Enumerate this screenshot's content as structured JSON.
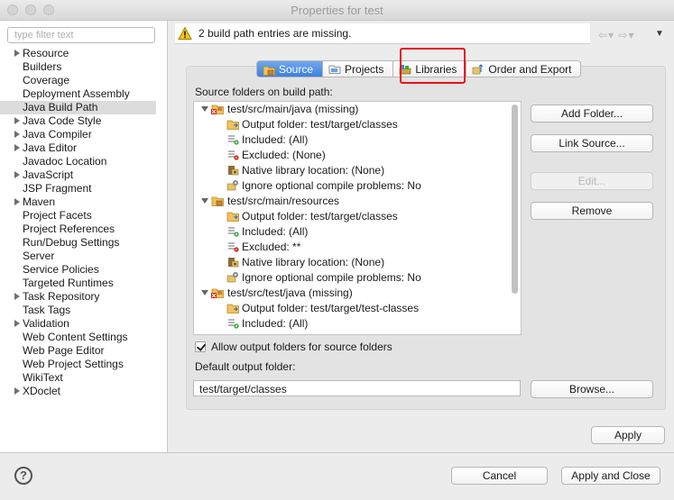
{
  "window": {
    "title": "Properties for test"
  },
  "sidebar": {
    "filter_placeholder": "type filter text",
    "items": [
      {
        "label": "Resource",
        "expandable": true
      },
      {
        "label": "Builders",
        "expandable": false
      },
      {
        "label": "Coverage",
        "expandable": false
      },
      {
        "label": "Deployment Assembly",
        "expandable": false
      },
      {
        "label": "Java Build Path",
        "expandable": false,
        "selected": true
      },
      {
        "label": "Java Code Style",
        "expandable": true
      },
      {
        "label": "Java Compiler",
        "expandable": true
      },
      {
        "label": "Java Editor",
        "expandable": true
      },
      {
        "label": "Javadoc Location",
        "expandable": false
      },
      {
        "label": "JavaScript",
        "expandable": true
      },
      {
        "label": "JSP Fragment",
        "expandable": false
      },
      {
        "label": "Maven",
        "expandable": true
      },
      {
        "label": "Project Facets",
        "expandable": false
      },
      {
        "label": "Project References",
        "expandable": false
      },
      {
        "label": "Run/Debug Settings",
        "expandable": false
      },
      {
        "label": "Server",
        "expandable": false
      },
      {
        "label": "Service Policies",
        "expandable": false
      },
      {
        "label": "Targeted Runtimes",
        "expandable": false
      },
      {
        "label": "Task Repository",
        "expandable": true
      },
      {
        "label": "Task Tags",
        "expandable": false
      },
      {
        "label": "Validation",
        "expandable": true
      },
      {
        "label": "Web Content Settings",
        "expandable": false
      },
      {
        "label": "Web Page Editor",
        "expandable": false
      },
      {
        "label": "Web Project Settings",
        "expandable": false
      },
      {
        "label": "WikiText",
        "expandable": false
      },
      {
        "label": "XDoclet",
        "expandable": true
      }
    ]
  },
  "message": {
    "text": "2 build path entries are missing.",
    "icon": "warning-icon"
  },
  "tabs": [
    {
      "label": "Source",
      "icon": "source-folder-icon",
      "active": true
    },
    {
      "label": "Projects",
      "icon": "projects-icon",
      "active": false
    },
    {
      "label": "Libraries",
      "icon": "libraries-icon",
      "active": false
    },
    {
      "label": "Order and Export",
      "icon": "order-export-icon",
      "active": false
    }
  ],
  "source": {
    "label": "Source folders on build path:",
    "tree": [
      {
        "text": "test/src/main/java (missing)",
        "level": 0,
        "icon": "missing-source-folder-icon"
      },
      {
        "text": "Output folder: test/target/classes",
        "level": 1,
        "icon": "output-folder-icon"
      },
      {
        "text": "Included: (All)",
        "level": 1,
        "icon": "included-icon"
      },
      {
        "text": "Excluded: (None)",
        "level": 1,
        "icon": "excluded-icon"
      },
      {
        "text": "Native library location: (None)",
        "level": 1,
        "icon": "native-library-icon"
      },
      {
        "text": "Ignore optional compile problems: No",
        "level": 1,
        "icon": "ignore-problems-icon"
      },
      {
        "text": "test/src/main/resources",
        "level": 0,
        "icon": "source-folder-icon"
      },
      {
        "text": "Output folder: test/target/classes",
        "level": 1,
        "icon": "output-folder-icon"
      },
      {
        "text": "Included: (All)",
        "level": 1,
        "icon": "included-icon"
      },
      {
        "text": "Excluded: **",
        "level": 1,
        "icon": "excluded-icon"
      },
      {
        "text": "Native library location: (None)",
        "level": 1,
        "icon": "native-library-icon"
      },
      {
        "text": "Ignore optional compile problems: No",
        "level": 1,
        "icon": "ignore-problems-icon"
      },
      {
        "text": "test/src/test/java (missing)",
        "level": 0,
        "icon": "missing-source-folder-icon"
      },
      {
        "text": "Output folder: test/target/test-classes",
        "level": 1,
        "icon": "output-folder-icon"
      },
      {
        "text": "Included: (All)",
        "level": 1,
        "icon": "included-icon"
      }
    ],
    "buttons": {
      "add_folder": "Add Folder...",
      "link_source": "Link Source...",
      "edit": "Edit...",
      "remove": "Remove"
    },
    "allow_output_label": "Allow output folders for source folders",
    "default_output_label": "Default output folder:",
    "default_output_value": "test/target/classes",
    "browse": "Browse..."
  },
  "buttons": {
    "apply": "Apply",
    "cancel": "Cancel",
    "apply_close": "Apply and Close"
  },
  "colors": {
    "highlight": "#e5111b",
    "selected_tab": "#3d7fe0"
  }
}
